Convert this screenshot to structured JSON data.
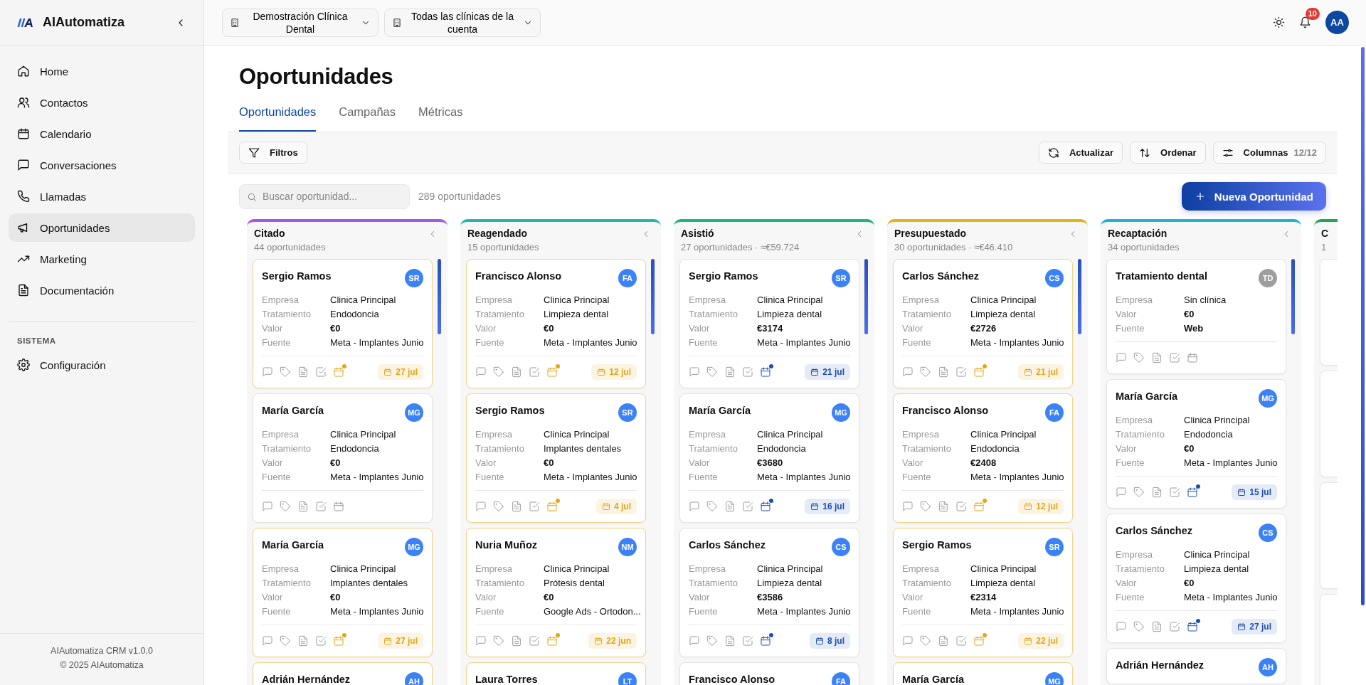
{
  "sidebar": {
    "brand": "AIAutomatiza",
    "nav": [
      {
        "label": "Home",
        "selected": false
      },
      {
        "label": "Contactos",
        "selected": false
      },
      {
        "label": "Calendario",
        "selected": false
      },
      {
        "label": "Conversaciones",
        "selected": false
      },
      {
        "label": "Llamadas",
        "selected": false
      },
      {
        "label": "Oportunidades",
        "selected": true
      },
      {
        "label": "Marketing",
        "selected": false
      },
      {
        "label": "Documentación",
        "selected": false
      }
    ],
    "section_label": "SISTEMA",
    "system_nav": [
      {
        "label": "Configuración",
        "selected": false
      }
    ],
    "footer": [
      "AIAutomatiza CRM v1.0.0",
      "© 2025 AIAutomatiza"
    ]
  },
  "topbar": {
    "selectors": [
      "Demostración Clínica Dental",
      "Todas las clínicas de la cuenta"
    ],
    "notifications": "10",
    "avatar": "AA"
  },
  "page": {
    "title": "Oportunidades",
    "tabs": [
      {
        "label": "Oportunidades",
        "selected": true
      },
      {
        "label": "Campañas",
        "selected": false
      },
      {
        "label": "Métricas",
        "selected": false
      }
    ],
    "filters": "Filtros",
    "actions": [
      {
        "label": "Actualizar"
      },
      {
        "label": "Ordenar"
      },
      {
        "label": "Columnas",
        "count": "12/12"
      }
    ],
    "search": {
      "placeholder": "Buscar oportunidad..."
    },
    "total": "289 oportunidades",
    "new_button": "Nueva Oportunidad"
  },
  "board": {
    "columns": [
      {
        "title": "Citado",
        "subtitle": "44 oportunidades",
        "color": "#a259e6",
        "cards": [
          {
            "name": "Sergio Ramos",
            "avatar": {
              "initials": "SR",
              "color": "#3b82f6"
            },
            "highlighted": true,
            "fields": [
              {
                "label": "Empresa",
                "value": "Clinica Principal"
              },
              {
                "label": "Tratamiento",
                "value": "Endodoncia"
              },
              {
                "label": "Valor",
                "value": "€0"
              },
              {
                "label": "Fuente",
                "value": "Meta - Implantes Junio"
              }
            ],
            "reminder": {
              "date": "27 jul",
              "color": "#e6a517"
            }
          },
          {
            "name": "María García",
            "avatar": {
              "initials": "MG",
              "color": "#3b82f6"
            },
            "highlighted": false,
            "fields": [
              {
                "label": "Empresa",
                "value": "Clinica Principal"
              },
              {
                "label": "Tratamiento",
                "value": "Endodoncia"
              },
              {
                "label": "Valor",
                "value": "€0"
              },
              {
                "label": "Fuente",
                "value": "Meta - Implantes Junio"
              }
            ]
          },
          {
            "name": "María García",
            "avatar": {
              "initials": "MG",
              "color": "#3b82f6"
            },
            "highlighted": true,
            "fields": [
              {
                "label": "Empresa",
                "value": "Clinica Principal"
              },
              {
                "label": "Tratamiento",
                "value": "Implantes dentales"
              },
              {
                "label": "Valor",
                "value": "€0"
              },
              {
                "label": "Fuente",
                "value": "Meta - Implantes Junio"
              }
            ],
            "reminder": {
              "date": "27 jul",
              "color": "#e6a517"
            }
          },
          {
            "name": "Adrián Hernández",
            "avatar": {
              "initials": "AH",
              "color": "#3b82f6"
            },
            "highlighted": true
          }
        ]
      },
      {
        "title": "Reagendado",
        "subtitle": "15 oportunidades",
        "color": "#2bb5a6",
        "cards": [
          {
            "name": "Francisco Alonso",
            "avatar": {
              "initials": "FA",
              "color": "#3b82f6"
            },
            "highlighted": true,
            "fields": [
              {
                "label": "Empresa",
                "value": "Clinica Principal"
              },
              {
                "label": "Tratamiento",
                "value": "Limpieza dental"
              },
              {
                "label": "Valor",
                "value": "€0"
              },
              {
                "label": "Fuente",
                "value": "Meta - Implantes Junio"
              }
            ],
            "reminder": {
              "date": "12 jul",
              "color": "#e6a517"
            }
          },
          {
            "name": "Sergio Ramos",
            "avatar": {
              "initials": "SR",
              "color": "#3b82f6"
            },
            "highlighted": true,
            "fields": [
              {
                "label": "Empresa",
                "value": "Clinica Principal"
              },
              {
                "label": "Tratamiento",
                "value": "Implantes dentales"
              },
              {
                "label": "Valor",
                "value": "€0"
              },
              {
                "label": "Fuente",
                "value": "Meta - Implantes Junio"
              }
            ],
            "reminder": {
              "date": "4 jul",
              "color": "#e6a517"
            }
          },
          {
            "name": "Nuria Muñoz",
            "avatar": {
              "initials": "NM",
              "color": "#3b82f6"
            },
            "highlighted": true,
            "fields": [
              {
                "label": "Empresa",
                "value": "Clinica Principal"
              },
              {
                "label": "Tratamiento",
                "value": "Prótesis dental"
              },
              {
                "label": "Valor",
                "value": "€0"
              },
              {
                "label": "Fuente",
                "value": "Google Ads - Ortodon..."
              }
            ],
            "reminder": {
              "date": "22 jun",
              "color": "#e6a517"
            }
          },
          {
            "name": "Laura Torres",
            "avatar": {
              "initials": "LT",
              "color": "#3b82f6"
            },
            "highlighted": true
          }
        ]
      },
      {
        "title": "Asistió",
        "subtitle": "27 oportunidades · ≈€59.724",
        "color": "#1fb57a",
        "cards": [
          {
            "name": "Sergio Ramos",
            "avatar": {
              "initials": "SR",
              "color": "#3b82f6"
            },
            "highlighted": false,
            "fields": [
              {
                "label": "Empresa",
                "value": "Clinica Principal"
              },
              {
                "label": "Tratamiento",
                "value": "Limpieza dental"
              },
              {
                "label": "Valor",
                "value": "€3174"
              },
              {
                "label": "Fuente",
                "value": "Meta - Implantes Junio"
              }
            ],
            "reminder": {
              "date": "21 jul",
              "color": "#1e4fb0"
            }
          },
          {
            "name": "María García",
            "avatar": {
              "initials": "MG",
              "color": "#3b82f6"
            },
            "highlighted": false,
            "fields": [
              {
                "label": "Empresa",
                "value": "Clinica Principal"
              },
              {
                "label": "Tratamiento",
                "value": "Endodoncia"
              },
              {
                "label": "Valor",
                "value": "€3680"
              },
              {
                "label": "Fuente",
                "value": "Meta - Implantes Junio"
              }
            ],
            "reminder": {
              "date": "16 jul",
              "color": "#1e4fb0"
            }
          },
          {
            "name": "Carlos Sánchez",
            "avatar": {
              "initials": "CS",
              "color": "#3b82f6"
            },
            "highlighted": false,
            "fields": [
              {
                "label": "Empresa",
                "value": "Clinica Principal"
              },
              {
                "label": "Tratamiento",
                "value": "Limpieza dental"
              },
              {
                "label": "Valor",
                "value": "€3586"
              },
              {
                "label": "Fuente",
                "value": "Meta - Implantes Junio"
              }
            ],
            "reminder": {
              "date": "8 jul",
              "color": "#1e4fb0"
            }
          },
          {
            "name": "Francisco Alonso",
            "avatar": {
              "initials": "FA",
              "color": "#3b82f6"
            },
            "highlighted": false
          }
        ]
      },
      {
        "title": "Presupuestado",
        "subtitle": "30 oportunidades · ≈€46.410",
        "color": "#e3b416",
        "cards": [
          {
            "name": "Carlos Sánchez",
            "avatar": {
              "initials": "CS",
              "color": "#3b82f6"
            },
            "highlighted": true,
            "fields": [
              {
                "label": "Empresa",
                "value": "Clinica Principal"
              },
              {
                "label": "Tratamiento",
                "value": "Limpieza dental"
              },
              {
                "label": "Valor",
                "value": "€2726"
              },
              {
                "label": "Fuente",
                "value": "Meta - Implantes Junio"
              }
            ],
            "reminder": {
              "date": "21 jul",
              "color": "#e6a517"
            }
          },
          {
            "name": "Francisco Alonso",
            "avatar": {
              "initials": "FA",
              "color": "#3b82f6"
            },
            "highlighted": true,
            "fields": [
              {
                "label": "Empresa",
                "value": "Clinica Principal"
              },
              {
                "label": "Tratamiento",
                "value": "Endodoncia"
              },
              {
                "label": "Valor",
                "value": "€2408"
              },
              {
                "label": "Fuente",
                "value": "Meta - Implantes Junio"
              }
            ],
            "reminder": {
              "date": "12 jul",
              "color": "#e6a517"
            }
          },
          {
            "name": "Sergio Ramos",
            "avatar": {
              "initials": "SR",
              "color": "#3b82f6"
            },
            "highlighted": true,
            "fields": [
              {
                "label": "Empresa",
                "value": "Clinica Principal"
              },
              {
                "label": "Tratamiento",
                "value": "Limpieza dental"
              },
              {
                "label": "Valor",
                "value": "€2314"
              },
              {
                "label": "Fuente",
                "value": "Meta - Implantes Junio"
              }
            ],
            "reminder": {
              "date": "22 jul",
              "color": "#e6a517"
            }
          },
          {
            "name": "María García",
            "avatar": {
              "initials": "MG",
              "color": "#3b82f6"
            },
            "highlighted": true
          }
        ]
      },
      {
        "title": "Recaptación",
        "subtitle": "34 oportunidades",
        "color": "#22b3d1",
        "cards": [
          {
            "name": "Tratamiento dental",
            "avatar": {
              "initials": "TD",
              "color": "#9e9e9e"
            },
            "highlighted": false,
            "fields": [
              {
                "label": "Empresa",
                "value": "Sin clínica"
              },
              {
                "label": "Valor",
                "value": "€0"
              },
              {
                "label": "Fuente",
                "value": "Web"
              }
            ]
          },
          {
            "name": "María García",
            "avatar": {
              "initials": "MG",
              "color": "#3b82f6"
            },
            "highlighted": false,
            "fields": [
              {
                "label": "Empresa",
                "value": "Clinica Principal"
              },
              {
                "label": "Tratamiento",
                "value": "Endodoncia"
              },
              {
                "label": "Valor",
                "value": "€0"
              },
              {
                "label": "Fuente",
                "value": "Meta - Implantes Junio"
              }
            ],
            "reminder": {
              "date": "15 jul",
              "color": "#1e4fb0"
            }
          },
          {
            "name": "Carlos Sánchez",
            "avatar": {
              "initials": "CS",
              "color": "#3b82f6"
            },
            "highlighted": false,
            "fields": [
              {
                "label": "Empresa",
                "value": "Clinica Principal"
              },
              {
                "label": "Tratamiento",
                "value": "Limpieza dental"
              },
              {
                "label": "Valor",
                "value": "€0"
              },
              {
                "label": "Fuente",
                "value": "Meta - Implantes Junio"
              }
            ],
            "reminder": {
              "date": "27 jul",
              "color": "#1e4fb0"
            }
          },
          {
            "name": "Adrián Hernández",
            "avatar": {
              "initials": "AH",
              "color": "#3b82f6"
            },
            "highlighted": false
          }
        ]
      },
      {
        "title": "C",
        "subtitle": "1",
        "color": "#22a55a",
        "cards": [
          {
            "highlighted": false
          },
          {
            "highlighted": false
          },
          {
            "highlighted": false
          },
          {
            "highlighted": false
          }
        ]
      }
    ]
  }
}
